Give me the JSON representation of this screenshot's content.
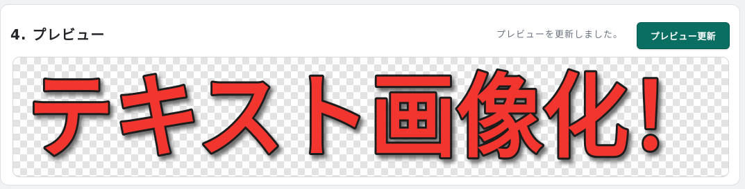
{
  "section": {
    "title": "4. プレビュー",
    "status_message": "プレビューを更新しました。",
    "refresh_button_label": "プレビュー更新"
  },
  "preview": {
    "text": "テキスト画像化！",
    "fill_color": "#f2362f",
    "outline_color": "#1a1a1a",
    "shadow_color": "#555555",
    "background": "transparent-checkerboard"
  }
}
